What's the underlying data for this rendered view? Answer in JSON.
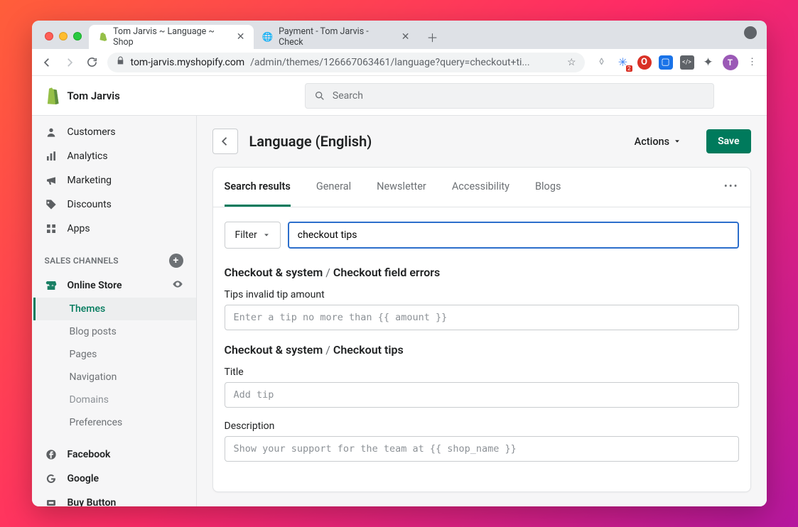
{
  "browser": {
    "tabs": [
      {
        "title": "Tom Jarvis ~ Language ~ Shop",
        "active": true
      },
      {
        "title": "Payment - Tom Jarvis - Check",
        "active": false
      }
    ],
    "url_domain": "tom-jarvis.myshopify.com",
    "url_path": "/admin/themes/126667063461/language?query=checkout+ti...",
    "avatar_letter": "T"
  },
  "shop": {
    "store_name": "Tom Jarvis",
    "search_placeholder": "Search"
  },
  "sidebar": {
    "items": [
      {
        "label": "Customers"
      },
      {
        "label": "Analytics"
      },
      {
        "label": "Marketing"
      },
      {
        "label": "Discounts"
      },
      {
        "label": "Apps"
      }
    ],
    "sales_channels_heading": "SALES CHANNELS",
    "online_store": "Online Store",
    "sub": [
      {
        "label": "Themes",
        "active": true
      },
      {
        "label": "Blog posts"
      },
      {
        "label": "Pages"
      },
      {
        "label": "Navigation"
      },
      {
        "label": "Domains",
        "muted": true
      },
      {
        "label": "Preferences"
      }
    ],
    "channels": [
      {
        "label": "Facebook"
      },
      {
        "label": "Google"
      },
      {
        "label": "Buy Button"
      }
    ]
  },
  "page": {
    "title": "Language (English)",
    "actions_label": "Actions",
    "save_label": "Save",
    "tabs": [
      "Search results",
      "General",
      "Newsletter",
      "Accessibility",
      "Blogs"
    ],
    "filter_label": "Filter",
    "search_value": "checkout tips",
    "sections": [
      {
        "group": "Checkout & system",
        "sub": "Checkout field errors",
        "fields": [
          {
            "label": "Tips invalid tip amount",
            "placeholder": "Enter a tip no more than {{ amount }}"
          }
        ]
      },
      {
        "group": "Checkout & system",
        "sub": "Checkout tips",
        "fields": [
          {
            "label": "Title",
            "placeholder": "Add tip"
          },
          {
            "label": "Description",
            "placeholder": "Show your support for the team at {{ shop_name }}"
          }
        ]
      }
    ]
  }
}
